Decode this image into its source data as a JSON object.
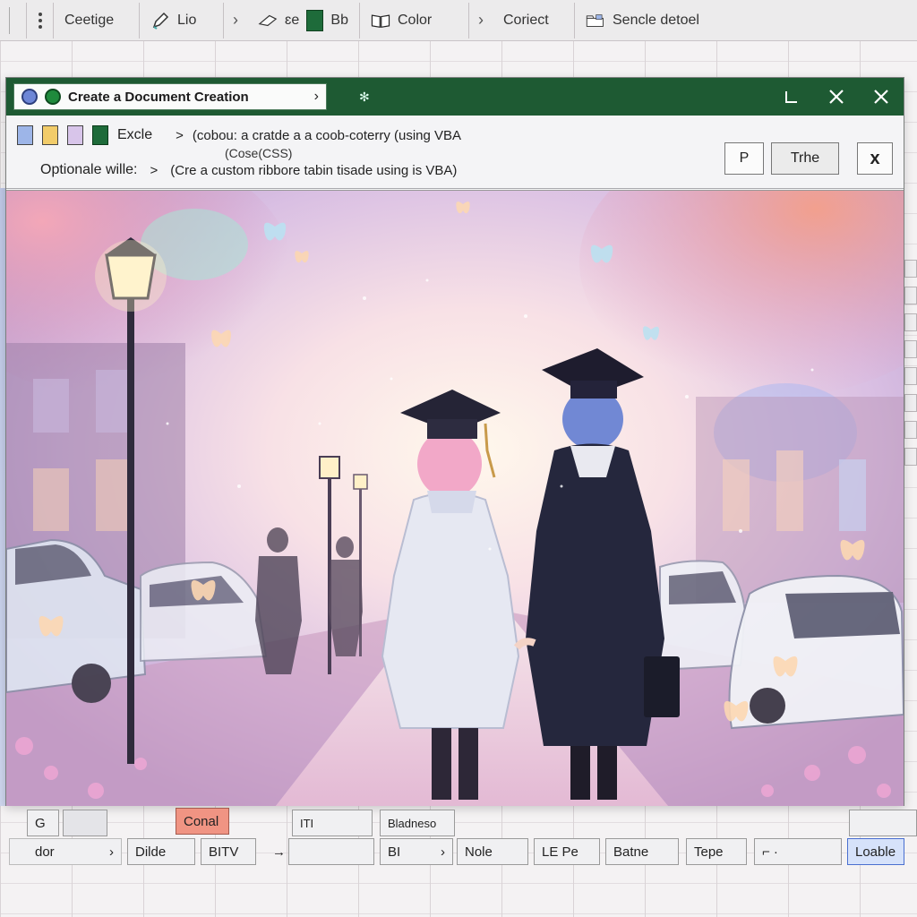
{
  "ribbon": {
    "item1": "Ceetige",
    "item2": "Lio",
    "item3": "ɛe",
    "item4": "Bb",
    "item5": "Color",
    "item6": "Coriect",
    "item7": "Sencle detoel"
  },
  "dialog": {
    "title": "Create a Document Creation",
    "excel_label": "Excle",
    "line1": "(cobou: a cratde a a coob-coterry (using VBA",
    "line1b": "(Cose(CSS)",
    "option_label": "Optionale wille:",
    "line2": "(Cre a custom ribbore tabin tisade using is VBA)",
    "btn_p": "P",
    "btn_the": "Trhe",
    "btn_x": "x"
  },
  "bottom": {
    "c1": "G",
    "c2": "Conal",
    "c3": "ITI",
    "c4": "Bladneso",
    "c5": "dor",
    "c6": "Dilde",
    "c7": "BITV",
    "c8": "BI",
    "c9": "Nole",
    "c10": "LE Pe",
    "c11": "Batne",
    "c12": "Tepe",
    "c13": "Loable"
  },
  "colors": {
    "titlebar": "#1e5a33",
    "excel_green": "#1e6b3a",
    "accent_blue": "#6d86d6"
  }
}
